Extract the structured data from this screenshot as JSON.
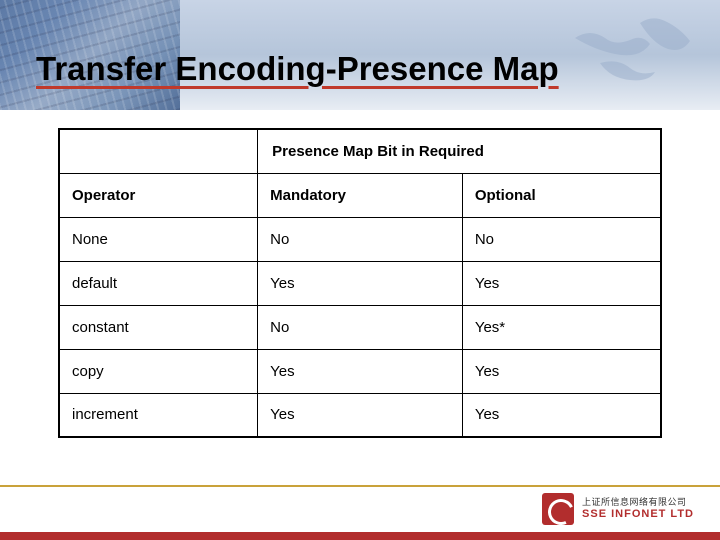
{
  "title": "Transfer Encoding-Presence Map",
  "table": {
    "mergedHeader": "Presence Map Bit in Required",
    "headers": {
      "operator": "Operator",
      "mandatory": "Mandatory",
      "optional": "Optional"
    },
    "rows": [
      {
        "operator": "None",
        "mandatory": "No",
        "optional": "No"
      },
      {
        "operator": "default",
        "mandatory": "Yes",
        "optional": "Yes"
      },
      {
        "operator": "constant",
        "mandatory": "No",
        "optional": "Yes*"
      },
      {
        "operator": "copy",
        "mandatory": "Yes",
        "optional": "Yes"
      },
      {
        "operator": "increment",
        "mandatory": "Yes",
        "optional": "Yes"
      }
    ]
  },
  "logo": {
    "cn": "上证所信息网络有限公司",
    "en": "SSE INFONET LTD"
  }
}
